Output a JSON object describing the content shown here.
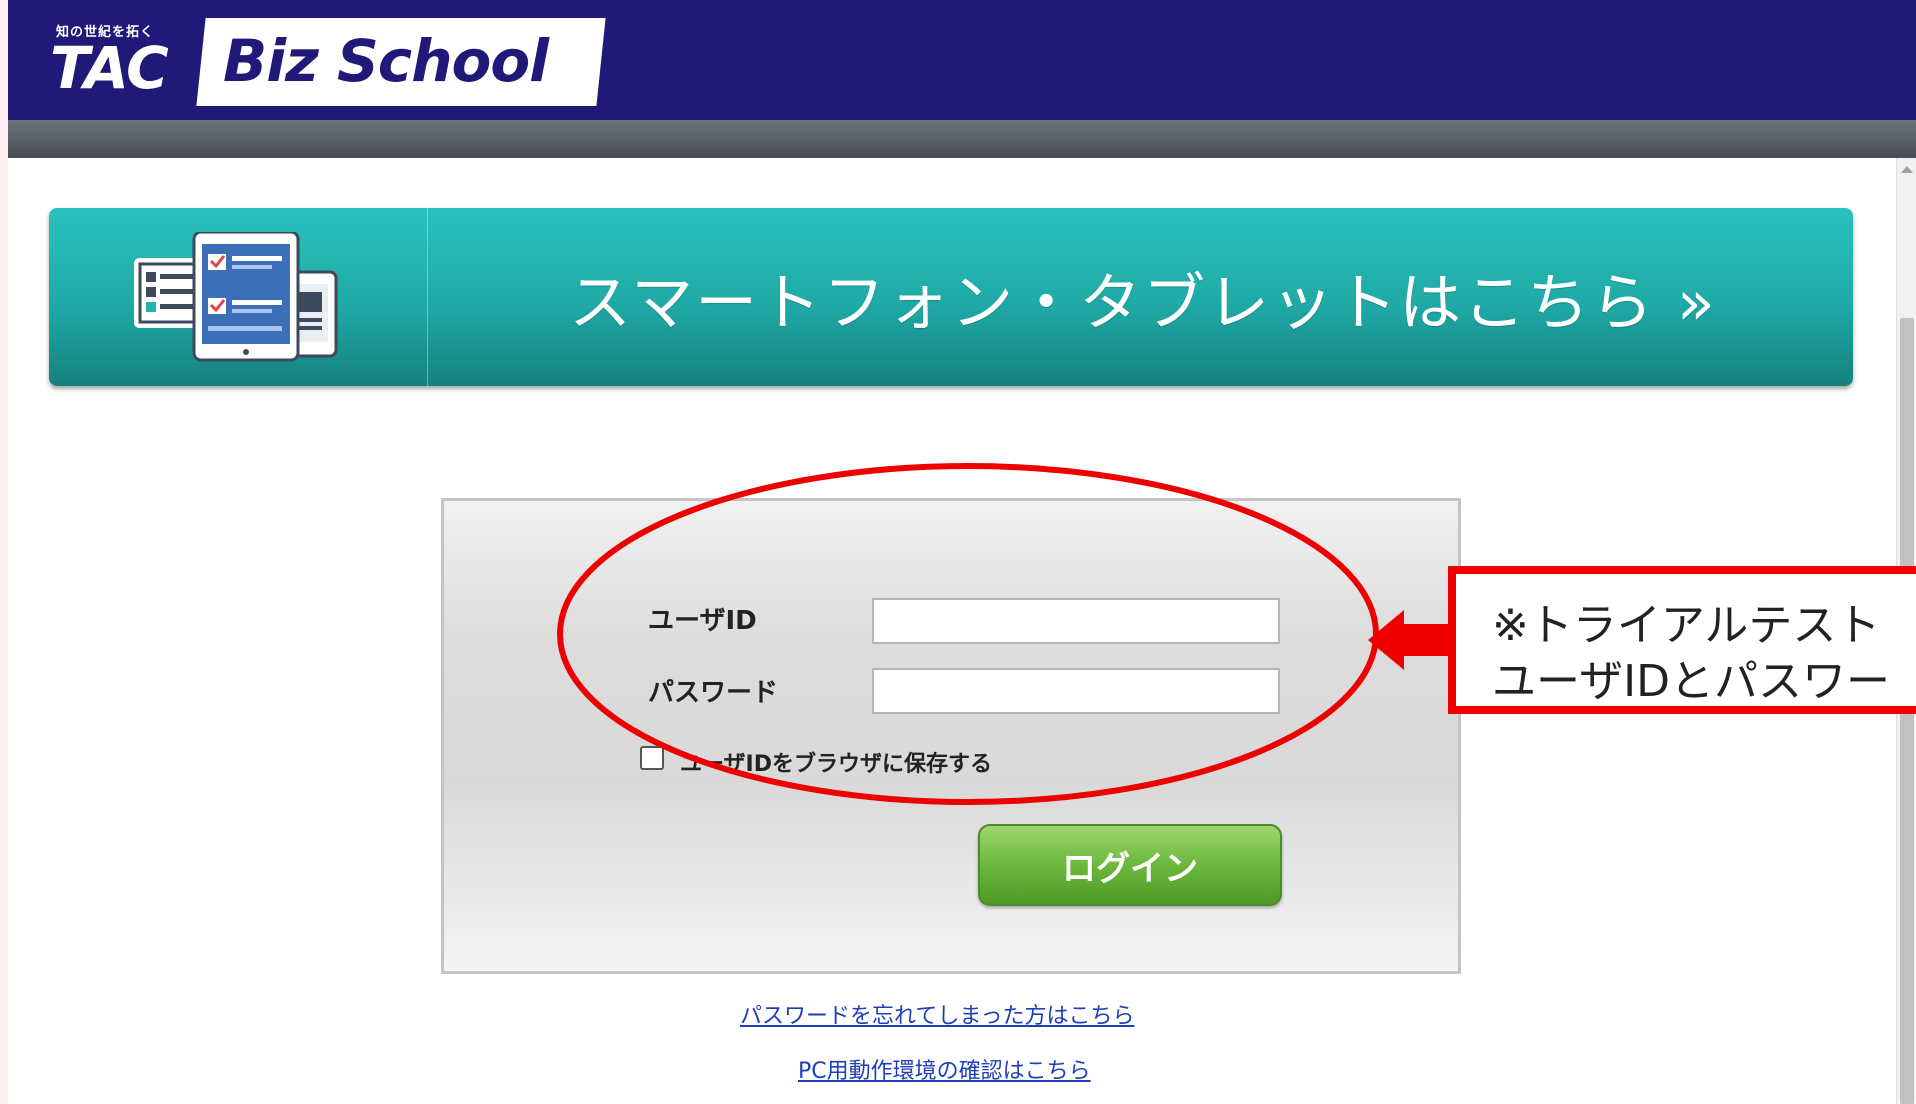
{
  "header": {
    "logo_tagline": "知の世紀を拓く",
    "logo_brand": "TAC",
    "logo_product": "Biz School"
  },
  "banner": {
    "text": "スマートフォン・タブレットはこちら »",
    "icon": "devices-icon"
  },
  "login": {
    "user_label": "ユーザID",
    "user_value": "",
    "password_label": "パスワード",
    "password_value": "",
    "remember_label": "ユーザIDをブラウザに保存する",
    "remember_checked": false,
    "submit_label": "ログイン"
  },
  "links": {
    "forgot_password": "パスワードを忘れてしまった方はこちら",
    "environment_check": "PC用動作環境の確認はこちら"
  },
  "annotation": {
    "line1": "※トライアルテスト",
    "line2": "ユーザIDとパスワー",
    "color": "#ee0000"
  },
  "colors": {
    "header_bg": "#211977",
    "banner_teal": "#1fa9a6",
    "login_green": "#6cb83d"
  }
}
